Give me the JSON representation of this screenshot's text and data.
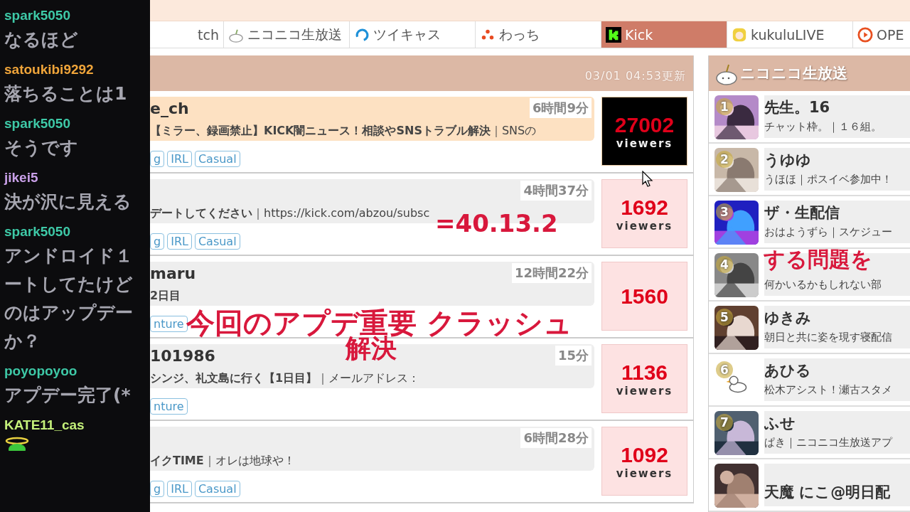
{
  "chat": {
    "messages": [
      {
        "kind": "text",
        "user": "spark5050",
        "color": "#3ec9a7",
        "lines": [
          "なるほど"
        ]
      },
      {
        "kind": "text",
        "user": "satoukibi9292",
        "color": "#f0a53a",
        "lines": [
          "落ちることは1"
        ]
      },
      {
        "kind": "text",
        "user": "spark5050",
        "color": "#3ec9a7",
        "lines": [
          "そうです"
        ]
      },
      {
        "kind": "text",
        "user": "jikei5",
        "color": "#c9a0e8",
        "lines": [
          "決が沢に見える"
        ]
      },
      {
        "kind": "text",
        "user": "spark5050",
        "color": "#3ec9a7",
        "lines": [
          "アンドロイド１",
          "ートしてたけど",
          "のはアップデー",
          "か？"
        ]
      },
      {
        "kind": "text",
        "user": "poyopoyoo",
        "color": "#3ec9a7",
        "lines": [
          "アプデー完了(*"
        ]
      },
      {
        "kind": "emoji",
        "user": "KATE11_cas",
        "color": "#c4f07a"
      }
    ]
  },
  "tabs": [
    {
      "label": "tch",
      "selected": false
    },
    {
      "label": "ニコニコ生放送",
      "selected": false
    },
    {
      "label": "ツイキャス",
      "selected": false
    },
    {
      "label": "わっち",
      "selected": false
    },
    {
      "label": "Kick",
      "selected": true
    },
    {
      "label": "kukuluLIVE",
      "selected": false
    },
    {
      "label": "OPE",
      "selected": false
    }
  ],
  "main": {
    "updated": "03/01 04:53更新",
    "streams": [
      {
        "name": "e_ch",
        "desc": "**【ミラー、録画禁止】KICK闇ニュース！相談やSNSトラブル解決**｜SNSの",
        "time": "6時間9分",
        "viewers": "27002",
        "unit": "viewers",
        "featured": true,
        "tags": [
          "g",
          "IRL",
          "Casual"
        ]
      },
      {
        "desc": "**デートしてください**｜https://kick.com/abzou/subsc",
        "time": "4時間37分",
        "viewers": "1692",
        "unit": "viewers",
        "featured": false,
        "tags": [
          "g",
          "IRL",
          "Casual"
        ]
      },
      {
        "name": "maru",
        "desc": "**2日目**",
        "time": "12時間22分",
        "viewers": "1560",
        "featured": false,
        "tags": [
          "nture"
        ]
      },
      {
        "name": "101986",
        "desc": "**シンジ、礼文島に行く【1日目】**｜メールアドレス：",
        "time": "15分",
        "viewers": "1136",
        "unit": "viewers",
        "featured": false,
        "tags": [
          "nture"
        ]
      },
      {
        "desc": "**イクTIME**｜オレは地球や！",
        "time": "6時間28分",
        "viewers": "1092",
        "unit": "viewers",
        "featured": false,
        "tags": [
          "g",
          "IRL",
          "Casual"
        ]
      }
    ]
  },
  "side": {
    "title": "ニコニコ生放送",
    "items": [
      {
        "rank": "1",
        "name": "先生。16",
        "desc": "チャット枠。｜１６組。",
        "kind": "picture"
      },
      {
        "rank": "2",
        "name": "うゆゆ",
        "desc": "うほほ｜ポスイベ参加中！",
        "kind": "picture"
      },
      {
        "rank": "3",
        "name": "ザ・生配信",
        "desc": "おはようずら｜スケジュー",
        "kind": "picture"
      },
      {
        "rank": "4",
        "desc": "何かいるかもしれない部",
        "kind": "picture"
      },
      {
        "rank": "5",
        "name": "ゆきみ",
        "desc": "朝日と共に姿を現す寝配信",
        "kind": "picture"
      },
      {
        "rank": "6",
        "name": "あひる",
        "desc": "松木アシスト！瀬古スタメ",
        "kind": "duck"
      },
      {
        "rank": "7",
        "name": "ふせ",
        "desc": "ぱき｜ニコニコ生放送アプ",
        "kind": "picture"
      },
      {
        "name": "天魔 にこ@明日配",
        "kind": "picture"
      }
    ]
  },
  "annotations": [
    "=40.13.2",
    "今回のアプデ重要 クラッシュ",
    "する問題を",
    "解決"
  ]
}
